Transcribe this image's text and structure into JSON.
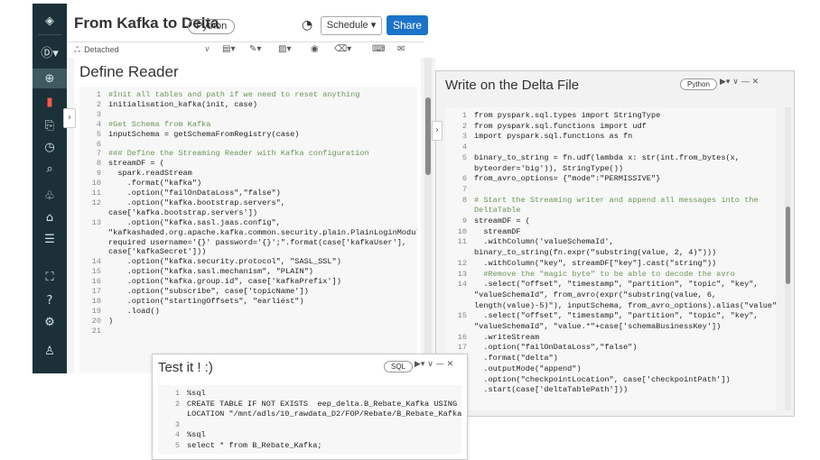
{
  "header": {
    "title": "From Kafka to Delta",
    "language": "Python",
    "schedule_label": "Schedule",
    "share_label": "Share"
  },
  "toolbar": {
    "cluster_status": "Detached"
  },
  "main_cell": {
    "title": "Define Reader",
    "lines": [
      {
        "n": "1",
        "t": "#Init all tables and path if we need to reset anything",
        "c": true
      },
      {
        "n": "2",
        "t": "initialisation_kafka(init, case)"
      },
      {
        "n": "3",
        "t": ""
      },
      {
        "n": "4",
        "t": "#Get Schema from Kafka",
        "c": true
      },
      {
        "n": "5",
        "t": "inputSchema = getSchemaFromRegistry(case)"
      },
      {
        "n": "6",
        "t": ""
      },
      {
        "n": "7",
        "t": "### Define the Streaming Reader with Kafka configuration",
        "c": true
      },
      {
        "n": "8",
        "t": "streamDF = ("
      },
      {
        "n": "9",
        "t": "  spark.readStream"
      },
      {
        "n": "10",
        "t": "    .format(\"kafka\")"
      },
      {
        "n": "11",
        "t": "    .option(\"failOnDataLoss\",\"false\")"
      },
      {
        "n": "12",
        "t": "    .option(\"kafka.bootstrap.servers\","
      },
      {
        "n": "",
        "t": "case['kafka.bootstrap.servers'])"
      },
      {
        "n": "13",
        "t": "    .option(\"kafka.sasl.jaas.config\","
      },
      {
        "n": "",
        "t": "\"kafkashaded.org.apache.kafka.common.security.plain.PlainLoginModule"
      },
      {
        "n": "",
        "t": "required username='{}' password='{}';\".format(case['kafkaUser'],"
      },
      {
        "n": "",
        "t": "case['kafkaSecret']))"
      },
      {
        "n": "14",
        "t": "    .option(\"kafka.security.protocol\", \"SASL_SSL\")"
      },
      {
        "n": "15",
        "t": "    .option(\"kafka.sasl.mechanism\", \"PLAIN\")"
      },
      {
        "n": "16",
        "t": "    .option(\"kafka.group.id\", case['kafkaPrefix'])"
      },
      {
        "n": "17",
        "t": "    .option(\"subscribe\", case['topicName'])"
      },
      {
        "n": "18",
        "t": "    .option(\"startingOffsets\", \"earliest\")"
      },
      {
        "n": "19",
        "t": "    .load()"
      },
      {
        "n": "20",
        "t": ")"
      },
      {
        "n": "21",
        "t": ""
      }
    ]
  },
  "right_cell": {
    "title": "Write on the Delta File",
    "language": "Python",
    "lines": [
      {
        "n": "1",
        "t": "from pyspark.sql.types import StringType"
      },
      {
        "n": "2",
        "t": "from pyspark.sql.functions import udf"
      },
      {
        "n": "3",
        "t": "import pyspark.sql.functions as fn"
      },
      {
        "n": "4",
        "t": ""
      },
      {
        "n": "5",
        "t": "binary_to_string = fn.udf(lambda x: str(int.from_bytes(x,"
      },
      {
        "n": "",
        "t": "byteorder='big')), StringType())"
      },
      {
        "n": "6",
        "t": "from_avro_options= {\"mode\":\"PERMISSIVE\"}"
      },
      {
        "n": "7",
        "t": ""
      },
      {
        "n": "8",
        "t": "# Start the Streaming writer and append all messages into the",
        "c": true
      },
      {
        "n": "",
        "t": "DeltaTable",
        "c": true
      },
      {
        "n": "9",
        "t": "streamDF = ("
      },
      {
        "n": "10",
        "t": "  streamDF"
      },
      {
        "n": "11",
        "t": "  .withColumn('valueSchemaId',"
      },
      {
        "n": "",
        "t": "binary_to_string(fn.expr(\"substring(value, 2, 4)\")))"
      },
      {
        "n": "12",
        "t": "  .withColumn(\"key\", streamDF[\"key\"].cast(\"string\"))"
      },
      {
        "n": "13",
        "t": "  #Remove the \"magic byte\" to be able to decode the avro",
        "c": true
      },
      {
        "n": "14",
        "t": "  .select(\"offset\", \"timestamp\", \"partition\", \"topic\", \"key\","
      },
      {
        "n": "",
        "t": "\"valueSchemaId\", from_avro(expr(\"substring(value, 6,"
      },
      {
        "n": "",
        "t": "length(value)-5)\"), inputSchema, from_avro_options).alias(\"value\"))"
      },
      {
        "n": "15",
        "t": "  .select(\"offset\", \"timestamp\", \"partition\", \"topic\", \"key\","
      },
      {
        "n": "",
        "t": "\"valueSchemaId\", \"value.*\"+case['schemaBusinessKey'])"
      },
      {
        "n": "16",
        "t": "  .writeStream"
      },
      {
        "n": "17",
        "t": "  .option(\"failOnDataLoss\",\"false\")"
      },
      {
        "n": "18",
        "t": "  .format(\"delta\")"
      },
      {
        "n": "19",
        "t": "  .outputMode(\"append\")"
      },
      {
        "n": "20",
        "t": "  .option(\"checkpointLocation\", case['checkpointPath'])"
      },
      {
        "n": "21",
        "t": "  .start(case['deltaTablePath']))"
      }
    ]
  },
  "test_cell": {
    "title": "Test it ! :)",
    "language": "SQL",
    "lines": [
      {
        "n": "1",
        "t": "%sql"
      },
      {
        "n": "2",
        "t": "CREATE TABLE IF NOT EXISTS  eep_delta.B_Rebate_Kafka USING DELTA"
      },
      {
        "n": "",
        "t": "LOCATION \"/mnt/adls/10_rawdata_D2/FOP/Rebate/B_Rebate_Kafka\""
      },
      {
        "n": "3",
        "t": ""
      },
      {
        "n": "4",
        "t": "%sql"
      },
      {
        "n": "5",
        "t": "select * from B_Rebate_Kafka;"
      }
    ]
  },
  "colors": {
    "sidebar_bg": "#1b3139",
    "share_blue": "#1b73c9",
    "keyword": "#8b1a5b",
    "string": "#a31515",
    "comment": "#6a9955"
  }
}
